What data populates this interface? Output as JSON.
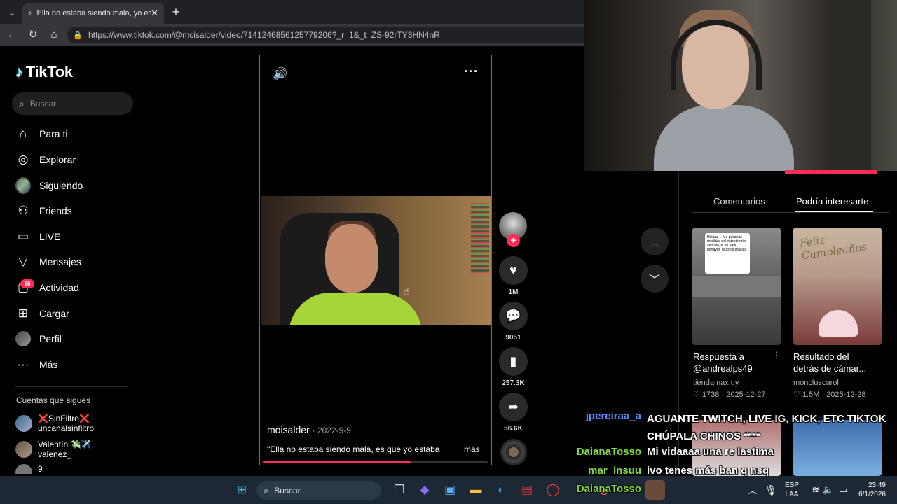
{
  "browser": {
    "tab_title": "Ella no estaba siendo mala, yo esta",
    "url": "https://www.tiktok.com/@mcisalder/video/7141246856125779206?_r=1&_t=ZS-92rTY3HN4nR"
  },
  "tiktok": {
    "logo": "TikTok",
    "search_placeholder": "Buscar",
    "nav": [
      {
        "label": "Para ti",
        "icon": "home-icon"
      },
      {
        "label": "Explorar",
        "icon": "compass-icon"
      },
      {
        "label": "Siguiendo",
        "icon": "following-avatar"
      },
      {
        "label": "Friends",
        "icon": "friends-icon"
      },
      {
        "label": "LIVE",
        "icon": "live-icon"
      },
      {
        "label": "Mensajes",
        "icon": "messages-icon"
      },
      {
        "label": "Actividad",
        "icon": "activity-icon"
      },
      {
        "label": "Cargar",
        "icon": "upload-icon"
      },
      {
        "label": "Perfil",
        "icon": "profile-avatar"
      },
      {
        "label": "Más",
        "icon": "more-icon"
      }
    ],
    "activity_badge": "16",
    "following_title": "Cuentas que sigues",
    "following": [
      {
        "name": "❌SinFiltro❌",
        "handle": "uncanalsinfiltro"
      },
      {
        "name": "Valentín 💸✈️",
        "handle": "valenez_"
      },
      {
        "name": "9",
        "handle": ""
      }
    ]
  },
  "video": {
    "author": "moisalder",
    "date": "2022-9-9",
    "caption": "\"Ella no estaba siendo mala, es que yo estaba",
    "more": "más",
    "progress": 0.66,
    "likes": "1M",
    "comments": "9051",
    "saves": "257.3K",
    "shares": "56.6K"
  },
  "right_panel": {
    "tabs": [
      "Comentarios",
      "Podría interesarte"
    ],
    "active_tab": 1,
    "videos": [
      {
        "title": "Respuesta a @andrealps49",
        "user": "tiendamax.uy",
        "likes": "1738",
        "date": "2025-12-27",
        "thumb_text": "Holaaa… Me pasarías medidas del estante más sencillo, el de $490 porfavor. Muchas gracias"
      },
      {
        "title": "Resultado del detrás de cámar...",
        "user": "moncluscarol",
        "likes": "1.5M",
        "date": "2025-12-28",
        "thumb_text": "Feliz Cumpleaños"
      }
    ]
  },
  "chat": [
    {
      "user": "jpereiraa_a",
      "color": "#5b8cff",
      "message": "AGUANTE TWITCH, LIVE IG, KICK, ETC TIKTOK CHÚPALA CHINOS ****"
    },
    {
      "user": "DaianaTosso",
      "color": "#7fdc3c",
      "message": "Mi vidaaaa una re lastima"
    },
    {
      "user": "mar_insuu",
      "color": "#7fdc3c",
      "message": "ivo tenes más ban q nsq"
    },
    {
      "user": "DaianaTosso",
      "color": "#7fdc3c",
      "message": ""
    }
  ],
  "taskbar": {
    "search": "Buscar",
    "lang_line1": "ESP",
    "lang_line2": "LAA",
    "time": "23:49",
    "date": "6/1/2026"
  }
}
